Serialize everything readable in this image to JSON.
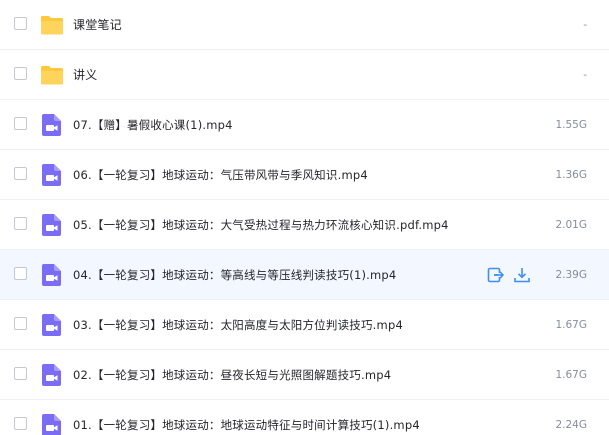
{
  "rows": [
    {
      "type": "folder",
      "name": "课堂笔记",
      "size": "-"
    },
    {
      "type": "folder",
      "name": "讲义",
      "size": "-"
    },
    {
      "type": "video",
      "name": "07.【赠】暑假收心课(1).mp4",
      "size": "1.55G"
    },
    {
      "type": "video",
      "name": "06.【一轮复习】地球运动：气压带风带与季风知识.mp4",
      "size": "1.36G"
    },
    {
      "type": "video",
      "name": "05.【一轮复习】地球运动：大气受热过程与热力环流核心知识.pdf.mp4",
      "size": "2.01G"
    },
    {
      "type": "video",
      "name": "04.【一轮复习】地球运动：等高线与等压线判读技巧(1).mp4",
      "size": "2.39G"
    },
    {
      "type": "video",
      "name": "03.【一轮复习】地球运动：太阳高度与太阳方位判读技巧.mp4",
      "size": "1.67G"
    },
    {
      "type": "video",
      "name": "02.【一轮复习】地球运动：昼夜长短与光照图解题技巧.mp4",
      "size": "1.67G"
    },
    {
      "type": "video",
      "name": "01.【一轮复习】地球运动：地球运动特征与时间计算技巧(1).mp4",
      "size": "2.24G"
    }
  ],
  "hovered_row_index": 5,
  "row_actions": [
    "share-icon",
    "download-icon"
  ],
  "colors": {
    "folder": "#ffc83d",
    "video_icon": "#7b6cf6",
    "action_icon": "#3f8ef5",
    "hover_bg": "#f3f7ff"
  }
}
